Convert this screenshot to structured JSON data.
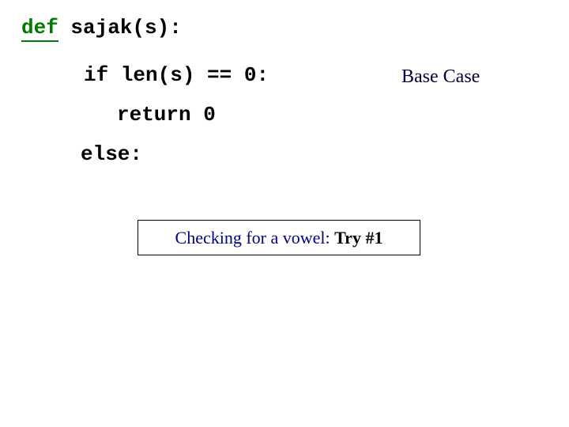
{
  "code": {
    "kw_def": "def",
    "sig": " sajak(s):",
    "kw_if": "if",
    "cond": " len(s) == 0:",
    "kw_return": "return",
    "ret_val": " 0",
    "kw_else": "else",
    "else_colon": ":"
  },
  "annotation": "Base Case",
  "box": {
    "prefix": "Checking for a vowel:  ",
    "strong": "Try #1"
  }
}
